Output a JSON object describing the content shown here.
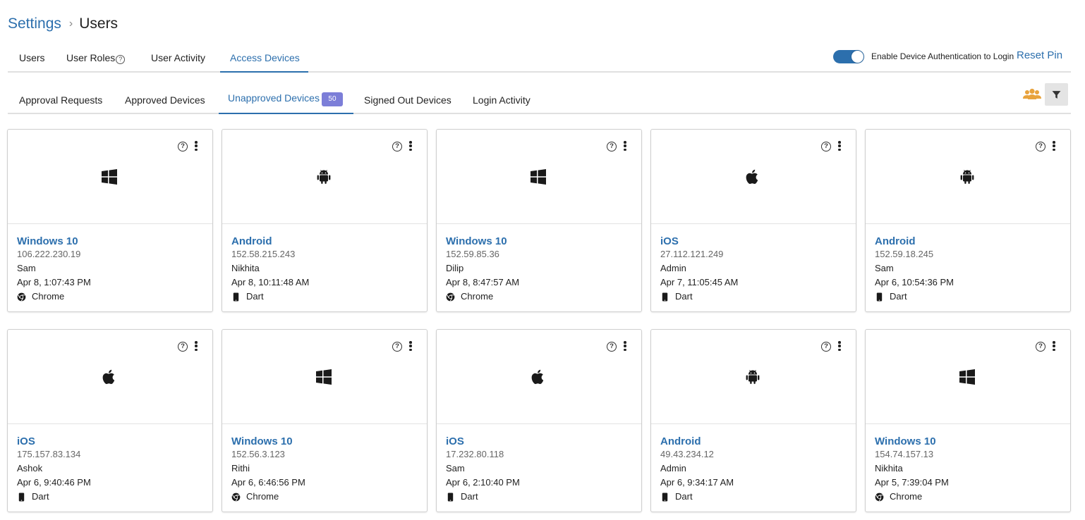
{
  "breadcrumb": {
    "parent": "Settings",
    "separator": "›",
    "current": "Users"
  },
  "main_tabs": [
    {
      "label": "Users",
      "active": false
    },
    {
      "label": "User Roles",
      "active": false,
      "help_icon": "?"
    },
    {
      "label": "User Activity",
      "active": false
    },
    {
      "label": "Access Devices",
      "active": true
    }
  ],
  "device_auth": {
    "label": "Enable Device Authentication to Login",
    "enabled": true,
    "reset_label": "Reset Pin"
  },
  "sub_tabs": [
    {
      "label": "Approval Requests",
      "active": false
    },
    {
      "label": "Approved Devices",
      "active": false
    },
    {
      "label": "Unapproved Devices",
      "active": true,
      "count": "50"
    },
    {
      "label": "Signed Out Devices",
      "active": false
    },
    {
      "label": "Login Activity",
      "active": false
    }
  ],
  "toolbar": {
    "users_icon": "users-group-icon",
    "filter_icon": "filter-icon"
  },
  "colors": {
    "accent": "#2c6fad",
    "badge": "#7c7ed8",
    "users_icon": "#e8a33d"
  },
  "card_icons": {
    "help": "?",
    "menu": "more-vertical-icon"
  },
  "devices": [
    {
      "os": "Windows 10",
      "os_icon": "windows-icon",
      "ip": "106.222.230.19",
      "user": "Sam",
      "date": "Apr 8, 1:07:43 PM",
      "client": "Chrome",
      "client_icon": "chrome-icon"
    },
    {
      "os": "Android",
      "os_icon": "android-icon",
      "ip": "152.58.215.243",
      "user": "Nikhita",
      "date": "Apr 8, 10:11:48 AM",
      "client": "Dart",
      "client_icon": "mobile-icon"
    },
    {
      "os": "Windows 10",
      "os_icon": "windows-icon",
      "ip": "152.59.85.36",
      "user": "Dilip",
      "date": "Apr 8, 8:47:57 AM",
      "client": "Chrome",
      "client_icon": "chrome-icon"
    },
    {
      "os": "iOS",
      "os_icon": "apple-icon",
      "ip": "27.112.121.249",
      "user": "Admin",
      "date": "Apr 7, 11:05:45 AM",
      "client": "Dart",
      "client_icon": "mobile-icon"
    },
    {
      "os": "Android",
      "os_icon": "android-icon",
      "ip": "152.59.18.245",
      "user": "Sam",
      "date": "Apr 6, 10:54:36 PM",
      "client": "Dart",
      "client_icon": "mobile-icon"
    },
    {
      "os": "iOS",
      "os_icon": "apple-icon",
      "ip": "175.157.83.134",
      "user": "Ashok",
      "date": "Apr 6, 9:40:46 PM",
      "client": "Dart",
      "client_icon": "mobile-icon"
    },
    {
      "os": "Windows 10",
      "os_icon": "windows-icon",
      "ip": "152.56.3.123",
      "user": "Rithi",
      "date": "Apr 6, 6:46:56 PM",
      "client": "Chrome",
      "client_icon": "chrome-icon"
    },
    {
      "os": "iOS",
      "os_icon": "apple-icon",
      "ip": "17.232.80.118",
      "user": "Sam",
      "date": "Apr 6, 2:10:40 PM",
      "client": "Dart",
      "client_icon": "mobile-icon"
    },
    {
      "os": "Android",
      "os_icon": "android-icon",
      "ip": "49.43.234.12",
      "user": "Admin",
      "date": "Apr 6, 9:34:17 AM",
      "client": "Dart",
      "client_icon": "mobile-icon"
    },
    {
      "os": "Windows 10",
      "os_icon": "windows-icon",
      "ip": "154.74.157.13",
      "user": "Nikhita",
      "date": "Apr 5, 7:39:04 PM",
      "client": "Chrome",
      "client_icon": "chrome-icon"
    }
  ]
}
